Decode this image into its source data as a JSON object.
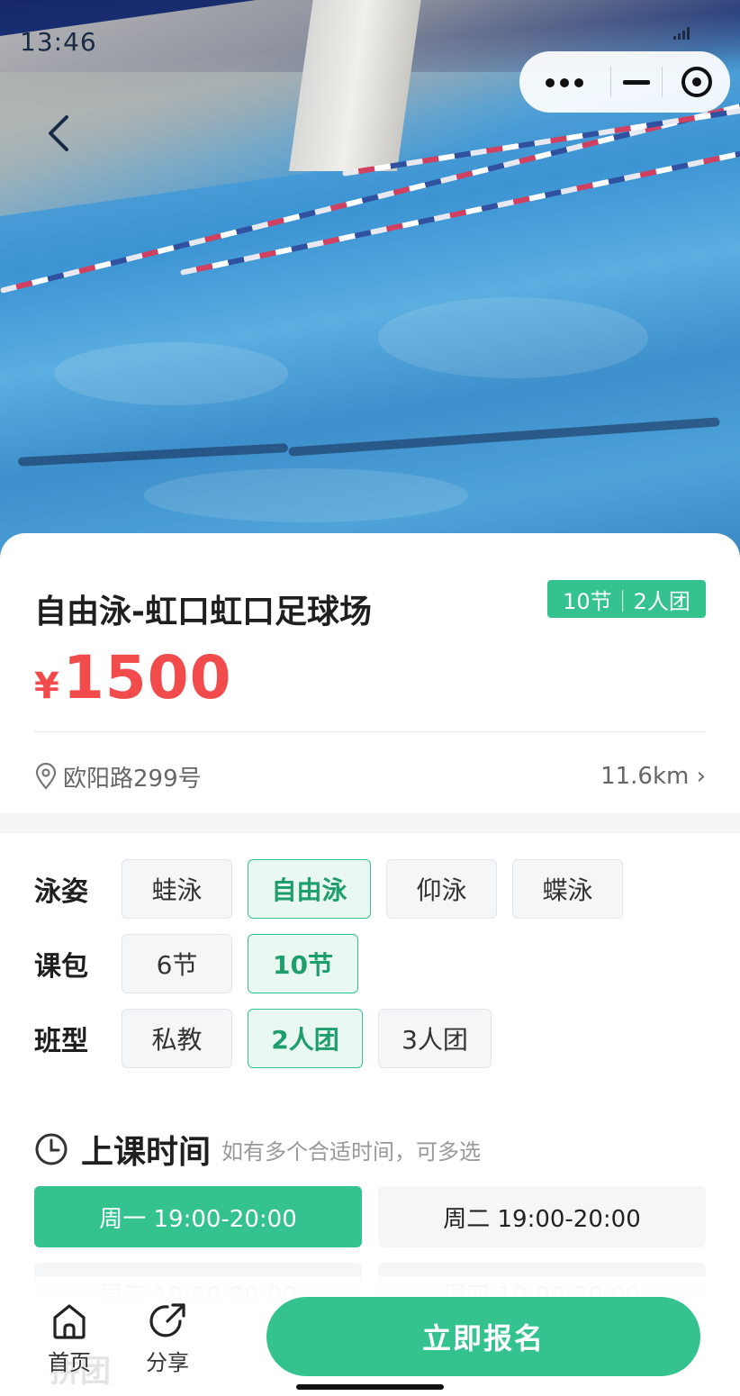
{
  "status_bar": {
    "time": "13:46"
  },
  "course": {
    "title": "自由泳-虹口虹口足球场",
    "tag": "10节｜2人团",
    "currency": "¥",
    "price": "1500",
    "address": "欧阳路299号",
    "distance": "11.6km ›"
  },
  "options": [
    {
      "label": "泳姿",
      "choices": [
        "蛙泳",
        "自由泳",
        "仰泳",
        "蝶泳"
      ],
      "selected": "自由泳"
    },
    {
      "label": "课包",
      "choices": [
        "6节",
        "10节"
      ],
      "selected": "10节"
    },
    {
      "label": "班型",
      "choices": [
        "私教",
        "2人团",
        "3人团"
      ],
      "selected": "2人团"
    }
  ],
  "schedule": {
    "heading": "上课时间",
    "hint": "如有多个合适时间，可多选",
    "slots": [
      "周一 19:00-20:00",
      "周二 19:00-20:00",
      "周三 19:00-20:00",
      "周四 19:00-20:00"
    ],
    "selected": [
      "周一 19:00-20:00"
    ]
  },
  "bottom_nav": {
    "home_label": "首页",
    "share_label": "分享",
    "cta_label": "立即报名",
    "obscured_text": "拼团"
  },
  "colors": {
    "accent": "#34c38f",
    "price": "#f24b4b"
  },
  "icons": [
    "back-icon",
    "more-icon",
    "minimize-icon",
    "close-target-icon",
    "location-pin-icon",
    "clock-icon",
    "home-icon",
    "share-icon"
  ]
}
